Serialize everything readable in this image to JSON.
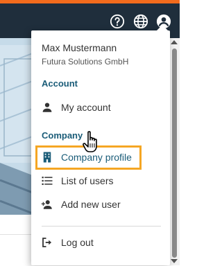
{
  "colors": {
    "accent_orange": "#f26b1d",
    "topbar": "#1f2e3c",
    "section_heading": "#1a5c78",
    "highlight_border": "#f5a623"
  },
  "topbar": {
    "icons": [
      "help-icon",
      "globe-icon",
      "account-circle-icon"
    ]
  },
  "menu": {
    "user_name": "Max Mustermann",
    "company_name": "Futura Solutions GmbH",
    "account_heading": "Account",
    "my_account": "My account",
    "company_heading": "Company",
    "company_profile": "Company profile",
    "list_of_users": "List of users",
    "add_new_user": "Add new user",
    "log_out": "Log out"
  }
}
